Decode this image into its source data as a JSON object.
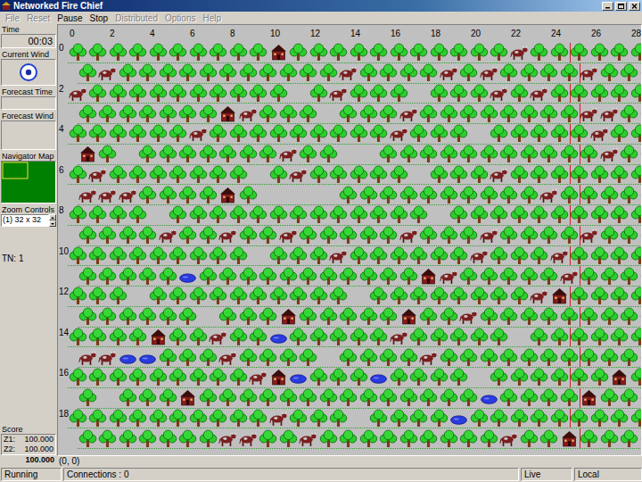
{
  "window": {
    "title": "Networked Fire Chief"
  },
  "menu": [
    {
      "label": "File",
      "disabled": true
    },
    {
      "label": "Reset",
      "disabled": true
    },
    {
      "label": "Pause",
      "disabled": false
    },
    {
      "label": "Stop",
      "disabled": false
    },
    {
      "label": "Distributed",
      "disabled": true
    },
    {
      "label": "Options",
      "disabled": true
    },
    {
      "label": "Help",
      "disabled": true
    }
  ],
  "panel": {
    "time": {
      "label": "Time",
      "value": "00:03"
    },
    "current_wind": {
      "label": "Current Wind"
    },
    "forecast_time": {
      "label": "Forecast Time"
    },
    "forecast_wind": {
      "label": "Forecast Wind"
    },
    "navigator": {
      "label": "Navigator Map"
    },
    "zoom": {
      "label": "Zoom Controls",
      "value": "(1) 32 x 32"
    },
    "tn": "TN: 1",
    "score": {
      "label": "Score",
      "zones": [
        {
          "label": "Z1:",
          "value": "100.000"
        },
        {
          "label": "Z2:",
          "value": "100.000"
        }
      ],
      "total": "100.000"
    }
  },
  "map": {
    "column_labels": [
      "0",
      "2",
      "4",
      "6",
      "8",
      "10",
      "12",
      "14",
      "16",
      "18",
      "20",
      "22",
      "24",
      "26",
      "28"
    ],
    "zone_divider_column": 25,
    "rows": [
      {
        "label": "0",
        "cells": [
          "tree",
          "tree",
          "tree",
          "tree",
          "tree",
          "tree",
          "tree",
          "tree",
          "tree",
          "tree",
          "farm",
          "tree",
          "tree",
          "tree",
          "tree",
          "tree",
          "tree",
          "tree",
          "tree",
          "tree",
          "tree",
          "tree",
          "cow",
          "tree",
          "tree",
          "tree",
          "tree",
          "tree",
          "tree"
        ]
      },
      {
        "cells": [
          "tree",
          "cow",
          "tree",
          "tree",
          "tree",
          "tree",
          "tree",
          "tree",
          "tree",
          "tree",
          "tree",
          "tree",
          "tree",
          "cow",
          "tree",
          "tree",
          "tree",
          "tree",
          "cow",
          "tree",
          "cow",
          "tree",
          "tree",
          "tree",
          "tree",
          "cow",
          "tree",
          "tree",
          "tree"
        ]
      },
      {
        "label": "2",
        "cells": [
          "cow",
          "tree",
          "tree",
          "tree",
          "tree",
          "tree",
          "tree",
          "tree",
          "tree",
          "tree",
          "tree",
          "bare",
          "tree",
          "cow",
          "tree",
          "tree",
          "tree",
          "bare",
          "tree",
          "tree",
          "tree",
          "cow",
          "tree",
          "cow",
          "tree",
          "tree",
          "tree",
          "tree",
          "tree"
        ]
      },
      {
        "cells": [
          "tree",
          "tree",
          "tree",
          "tree",
          "tree",
          "tree",
          "tree",
          "farm",
          "cow",
          "tree",
          "tree",
          "tree",
          "bare",
          "tree",
          "tree",
          "tree",
          "cow",
          "tree",
          "tree",
          "tree",
          "tree",
          "tree",
          "tree",
          "tree",
          "tree",
          "cow",
          "cow",
          "tree",
          "tree"
        ]
      },
      {
        "label": "4",
        "cells": [
          "tree",
          "tree",
          "tree",
          "tree",
          "tree",
          "tree",
          "cow",
          "tree",
          "tree",
          "tree",
          "tree",
          "tree",
          "tree",
          "tree",
          "tree",
          "tree",
          "cow",
          "tree",
          "tree",
          "tree",
          "bare",
          "tree",
          "tree",
          "tree",
          "tree",
          "tree",
          "cow",
          "tree",
          "tree"
        ]
      },
      {
        "cells": [
          "farm",
          "tree",
          "bare",
          "tree",
          "tree",
          "tree",
          "tree",
          "tree",
          "tree",
          "tree",
          "cow",
          "tree",
          "tree",
          "bare",
          "bare",
          "tree",
          "tree",
          "tree",
          "tree",
          "tree",
          "tree",
          "tree",
          "tree",
          "tree",
          "tree",
          "tree",
          "cow",
          "tree",
          "tree"
        ]
      },
      {
        "label": "6",
        "cells": [
          "tree",
          "cow",
          "tree",
          "tree",
          "tree",
          "tree",
          "tree",
          "tree",
          "tree",
          "bare",
          "tree",
          "cow",
          "tree",
          "tree",
          "tree",
          "tree",
          "tree",
          "bare",
          "tree",
          "tree",
          "tree",
          "cow",
          "tree",
          "tree",
          "tree",
          "tree",
          "tree",
          "tree",
          "tree"
        ]
      },
      {
        "cells": [
          "cow",
          "cow",
          "cow",
          "tree",
          "tree",
          "tree",
          "tree",
          "farm",
          "tree",
          "bare",
          "bare",
          "bare",
          "bare",
          "tree",
          "tree",
          "tree",
          "tree",
          "tree",
          "tree",
          "tree",
          "tree",
          "tree",
          "tree",
          "cow",
          "tree",
          "tree",
          "tree",
          "tree",
          "tree"
        ]
      },
      {
        "label": "8",
        "cells": [
          "tree",
          "tree",
          "tree",
          "tree",
          "bare",
          "tree",
          "tree",
          "tree",
          "tree",
          "tree",
          "tree",
          "tree",
          "tree",
          "tree",
          "tree",
          "tree",
          "tree",
          "tree",
          "bare",
          "tree",
          "tree",
          "tree",
          "tree",
          "tree",
          "tree",
          "tree",
          "tree",
          "tree",
          "tree"
        ]
      },
      {
        "cells": [
          "tree",
          "tree",
          "tree",
          "tree",
          "cow",
          "tree",
          "tree",
          "cow",
          "tree",
          "tree",
          "cow",
          "tree",
          "tree",
          "tree",
          "tree",
          "tree",
          "cow",
          "tree",
          "tree",
          "tree",
          "cow",
          "tree",
          "tree",
          "tree",
          "tree",
          "cow",
          "tree",
          "tree",
          "tree"
        ]
      },
      {
        "label": "10",
        "cells": [
          "tree",
          "tree",
          "tree",
          "tree",
          "tree",
          "tree",
          "tree",
          "tree",
          "tree",
          "bare",
          "tree",
          "tree",
          "tree",
          "cow",
          "tree",
          "tree",
          "tree",
          "tree",
          "tree",
          "tree",
          "cow",
          "tree",
          "tree",
          "tree",
          "cow",
          "tree",
          "tree",
          "tree",
          "tree"
        ]
      },
      {
        "cells": [
          "tree",
          "tree",
          "tree",
          "tree",
          "tree",
          "pond",
          "tree",
          "tree",
          "tree",
          "tree",
          "tree",
          "tree",
          "tree",
          "tree",
          "tree",
          "tree",
          "tree",
          "farm",
          "cow",
          "tree",
          "tree",
          "tree",
          "tree",
          "tree",
          "cow",
          "tree",
          "tree",
          "tree",
          "tree"
        ]
      },
      {
        "label": "12",
        "cells": [
          "tree",
          "tree",
          "tree",
          "bare",
          "tree",
          "tree",
          "tree",
          "tree",
          "tree",
          "tree",
          "tree",
          "tree",
          "tree",
          "tree",
          "bare",
          "tree",
          "tree",
          "tree",
          "tree",
          "tree",
          "tree",
          "tree",
          "tree",
          "cow",
          "farm",
          "tree",
          "tree",
          "tree",
          "tree"
        ]
      },
      {
        "cells": [
          "tree",
          "tree",
          "tree",
          "tree",
          "tree",
          "tree",
          "bare",
          "tree",
          "tree",
          "tree",
          "farm",
          "tree",
          "tree",
          "tree",
          "tree",
          "tree",
          "farm",
          "tree",
          "tree",
          "cow",
          "tree",
          "tree",
          "tree",
          "tree",
          "tree",
          "tree",
          "tree",
          "tree",
          "tree"
        ]
      },
      {
        "label": "14",
        "cells": [
          "tree",
          "tree",
          "tree",
          "tree",
          "farm",
          "tree",
          "tree",
          "cow",
          "tree",
          "tree",
          "pond",
          "tree",
          "tree",
          "tree",
          "tree",
          "tree",
          "cow",
          "tree",
          "tree",
          "tree",
          "tree",
          "tree",
          "bare",
          "tree",
          "tree",
          "tree",
          "tree",
          "tree",
          "tree"
        ]
      },
      {
        "cells": [
          "cow",
          "cow",
          "pond",
          "pond",
          "tree",
          "tree",
          "tree",
          "cow",
          "tree",
          "tree",
          "tree",
          "tree",
          "bare",
          "tree",
          "tree",
          "tree",
          "tree",
          "cow",
          "tree",
          "tree",
          "tree",
          "tree",
          "tree",
          "tree",
          "tree",
          "tree",
          "tree",
          "tree",
          "tree"
        ]
      },
      {
        "label": "16",
        "cells": [
          "tree",
          "tree",
          "tree",
          "tree",
          "tree",
          "tree",
          "tree",
          "tree",
          "tree",
          "cow",
          "farm",
          "pond",
          "tree",
          "tree",
          "tree",
          "pond",
          "tree",
          "tree",
          "tree",
          "tree",
          "bare",
          "tree",
          "tree",
          "tree",
          "tree",
          "tree",
          "tree",
          "farm",
          "tree"
        ]
      },
      {
        "cells": [
          "tree",
          "bare",
          "tree",
          "tree",
          "tree",
          "farm",
          "tree",
          "tree",
          "tree",
          "tree",
          "tree",
          "tree",
          "tree",
          "tree",
          "tree",
          "tree",
          "tree",
          "tree",
          "tree",
          "tree",
          "pond",
          "tree",
          "tree",
          "tree",
          "tree",
          "farm",
          "tree",
          "tree",
          "tree"
        ]
      },
      {
        "label": "18",
        "cells": [
          "tree",
          "tree",
          "tree",
          "tree",
          "tree",
          "tree",
          "tree",
          "tree",
          "tree",
          "tree",
          "cow",
          "tree",
          "tree",
          "tree",
          "bare",
          "tree",
          "tree",
          "tree",
          "tree",
          "pond",
          "tree",
          "tree",
          "tree",
          "tree",
          "tree",
          "tree",
          "tree",
          "tree",
          "tree"
        ]
      },
      {
        "cells": [
          "tree",
          "tree",
          "tree",
          "tree",
          "tree",
          "tree",
          "tree",
          "cow",
          "cow",
          "tree",
          "tree",
          "cow",
          "tree",
          "tree",
          "tree",
          "tree",
          "tree",
          "tree",
          "tree",
          "tree",
          "tree",
          "cow",
          "tree",
          "tree",
          "farm",
          "tree",
          "tree",
          "tree",
          "tree"
        ]
      }
    ]
  },
  "cursor": "(0, 0)",
  "status_bar": [
    "Running",
    "Connections : 0",
    "Live",
    "Local"
  ]
}
